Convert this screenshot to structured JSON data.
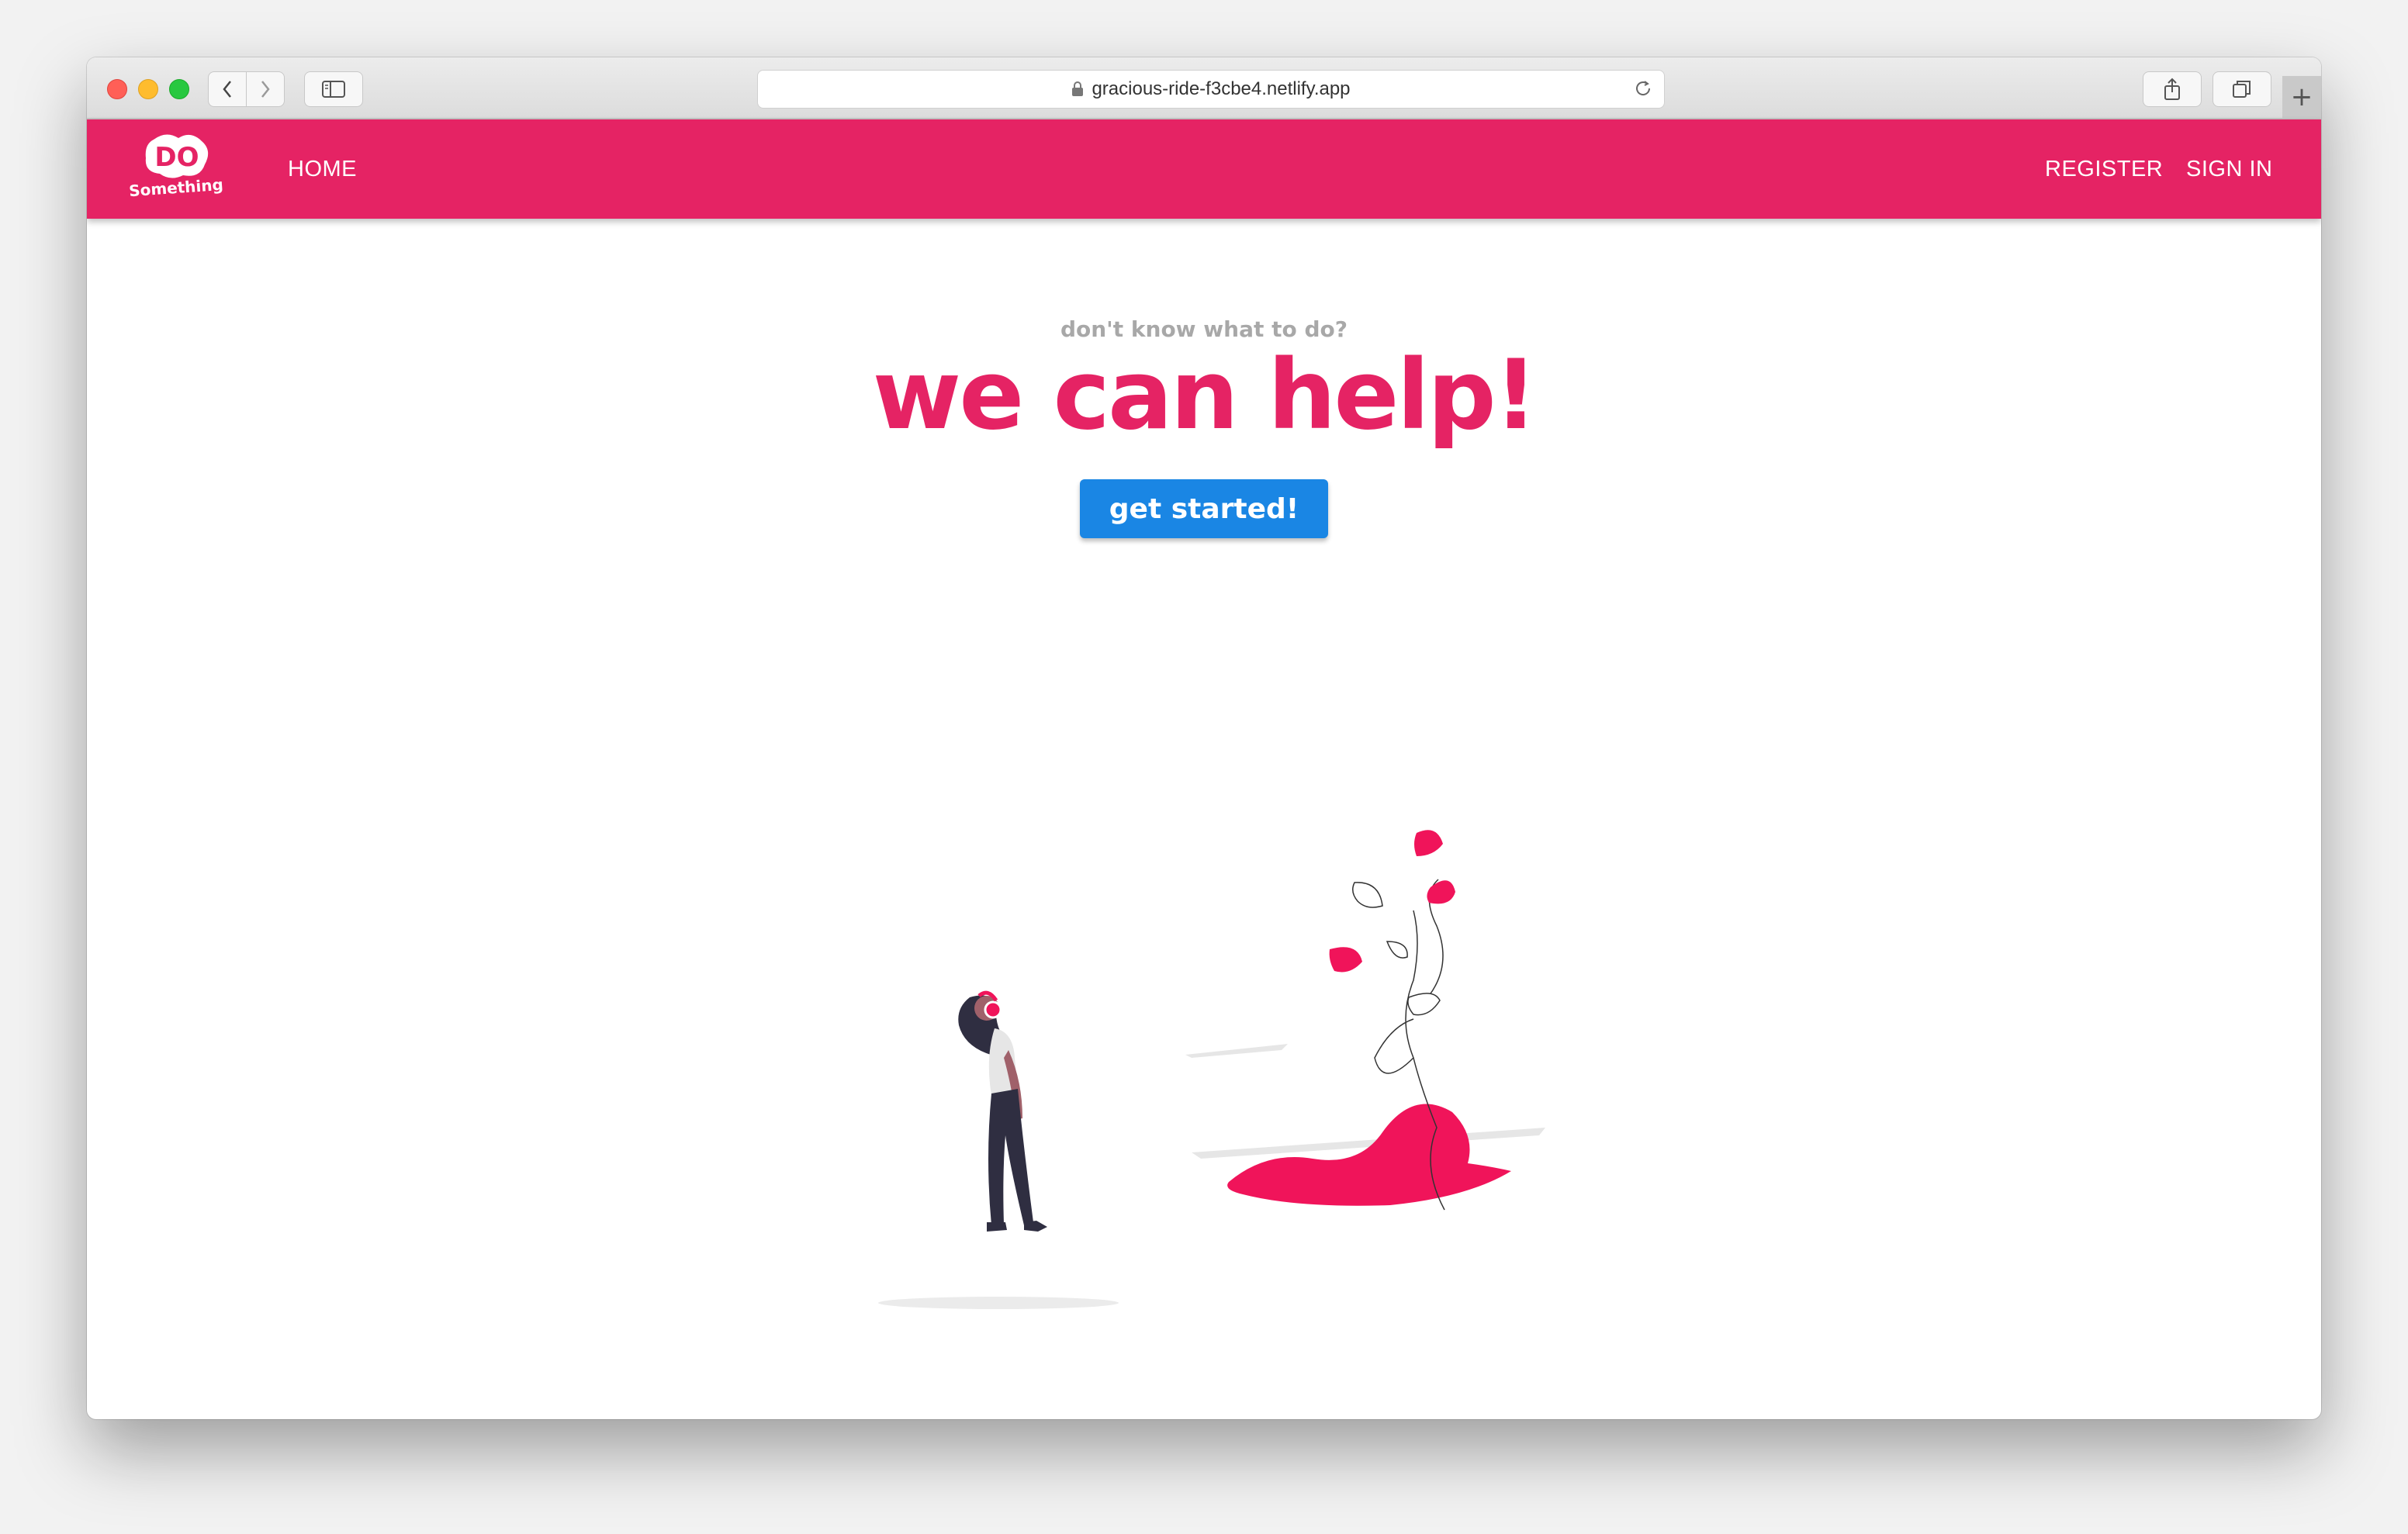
{
  "browser": {
    "url": "gracious-ride-f3cbe4.netlify.app",
    "new_tab_label": "+"
  },
  "header": {
    "logo": {
      "mark": "DO",
      "text": "Something"
    },
    "nav": {
      "home": "HOME",
      "register": "REGISTER",
      "sign_in": "SIGN IN"
    }
  },
  "hero": {
    "subtitle": "don't know what to do?",
    "title": "we can help!",
    "cta_label": "get started!"
  },
  "colors": {
    "brand": "#e52364",
    "cta": "#1a86e4",
    "subtitle": "#a8a8a8"
  }
}
